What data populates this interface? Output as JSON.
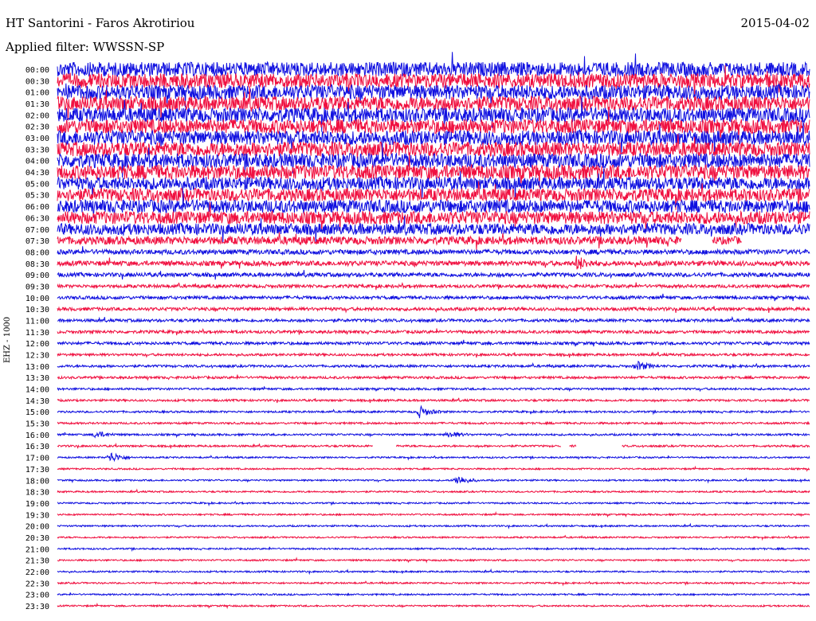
{
  "header": {
    "station": "HT Santorini - Faros Akrotiriou",
    "date": "2015-04-02",
    "filter": "Applied filter: WWSSN-SP",
    "channel": "EHZ - 1000"
  },
  "colors": {
    "blue": "#1010e0",
    "red": "#f01040"
  },
  "chart_data": {
    "type": "line",
    "title": "HT Santorini - Faros Akrotiriou",
    "ylabel": "EHZ - 1000",
    "rows": [
      {
        "label": "00:00",
        "amp": 9
      },
      {
        "label": "00:30",
        "amp": 9
      },
      {
        "label": "01:00",
        "amp": 9
      },
      {
        "label": "01:30",
        "amp": 9
      },
      {
        "label": "02:00",
        "amp": 9
      },
      {
        "label": "02:30",
        "amp": 9
      },
      {
        "label": "03:00",
        "amp": 9
      },
      {
        "label": "03:30",
        "amp": 9
      },
      {
        "label": "04:00",
        "amp": 9
      },
      {
        "label": "04:30",
        "amp": 9
      },
      {
        "label": "05:00",
        "amp": 8
      },
      {
        "label": "05:30",
        "amp": 8
      },
      {
        "label": "06:00",
        "amp": 8
      },
      {
        "label": "06:30",
        "amp": 8
      },
      {
        "label": "07:00",
        "amp": 7
      },
      {
        "label": "07:30",
        "amp": 5
      },
      {
        "label": "08:00",
        "amp": 3
      },
      {
        "label": "08:30",
        "amp": 3
      },
      {
        "label": "09:00",
        "amp": 2.5
      },
      {
        "label": "09:30",
        "amp": 2
      },
      {
        "label": "10:00",
        "amp": 2
      },
      {
        "label": "10:30",
        "amp": 2
      },
      {
        "label": "11:00",
        "amp": 1.8
      },
      {
        "label": "11:30",
        "amp": 1.8
      },
      {
        "label": "12:00",
        "amp": 1.8
      },
      {
        "label": "12:30",
        "amp": 1.5
      },
      {
        "label": "13:00",
        "amp": 1.5
      },
      {
        "label": "13:30",
        "amp": 1.5
      },
      {
        "label": "14:00",
        "amp": 1.3
      },
      {
        "label": "14:30",
        "amp": 1.3
      },
      {
        "label": "15:00",
        "amp": 1.2
      },
      {
        "label": "15:30",
        "amp": 1.2
      },
      {
        "label": "16:00",
        "amp": 1.2
      },
      {
        "label": "16:30",
        "amp": 1.2
      },
      {
        "label": "17:00",
        "amp": 1
      },
      {
        "label": "17:30",
        "amp": 1
      },
      {
        "label": "18:00",
        "amp": 1
      },
      {
        "label": "18:30",
        "amp": 1
      },
      {
        "label": "19:00",
        "amp": 1
      },
      {
        "label": "19:30",
        "amp": 1
      },
      {
        "label": "20:00",
        "amp": 1
      },
      {
        "label": "20:30",
        "amp": 1
      },
      {
        "label": "21:00",
        "amp": 1
      },
      {
        "label": "21:30",
        "amp": 1
      },
      {
        "label": "22:00",
        "amp": 1
      },
      {
        "label": "22:30",
        "amp": 1
      },
      {
        "label": "23:00",
        "amp": 1
      },
      {
        "label": "23:30",
        "amp": 1
      }
    ],
    "events": [
      {
        "row": "15:00",
        "x": 0.48,
        "amp": 8
      },
      {
        "row": "16:00",
        "x": 0.05,
        "amp": 5
      },
      {
        "row": "16:00",
        "x": 0.52,
        "amp": 4
      },
      {
        "row": "17:00",
        "x": 0.07,
        "amp": 7
      },
      {
        "row": "18:00",
        "x": 0.53,
        "amp": 7
      },
      {
        "row": "13:00",
        "x": 0.77,
        "amp": 6
      },
      {
        "row": "08:30",
        "x": 0.69,
        "amp": 8
      }
    ],
    "gaps": [
      {
        "row": "07:30",
        "start": 0.83,
        "end": 0.87
      },
      {
        "row": "07:30",
        "start": 0.91,
        "end": 1.0
      },
      {
        "row": "16:30",
        "start": 0.42,
        "end": 0.45
      },
      {
        "row": "16:30",
        "start": 0.67,
        "end": 0.68
      },
      {
        "row": "16:30",
        "start": 0.69,
        "end": 0.75
      }
    ]
  }
}
